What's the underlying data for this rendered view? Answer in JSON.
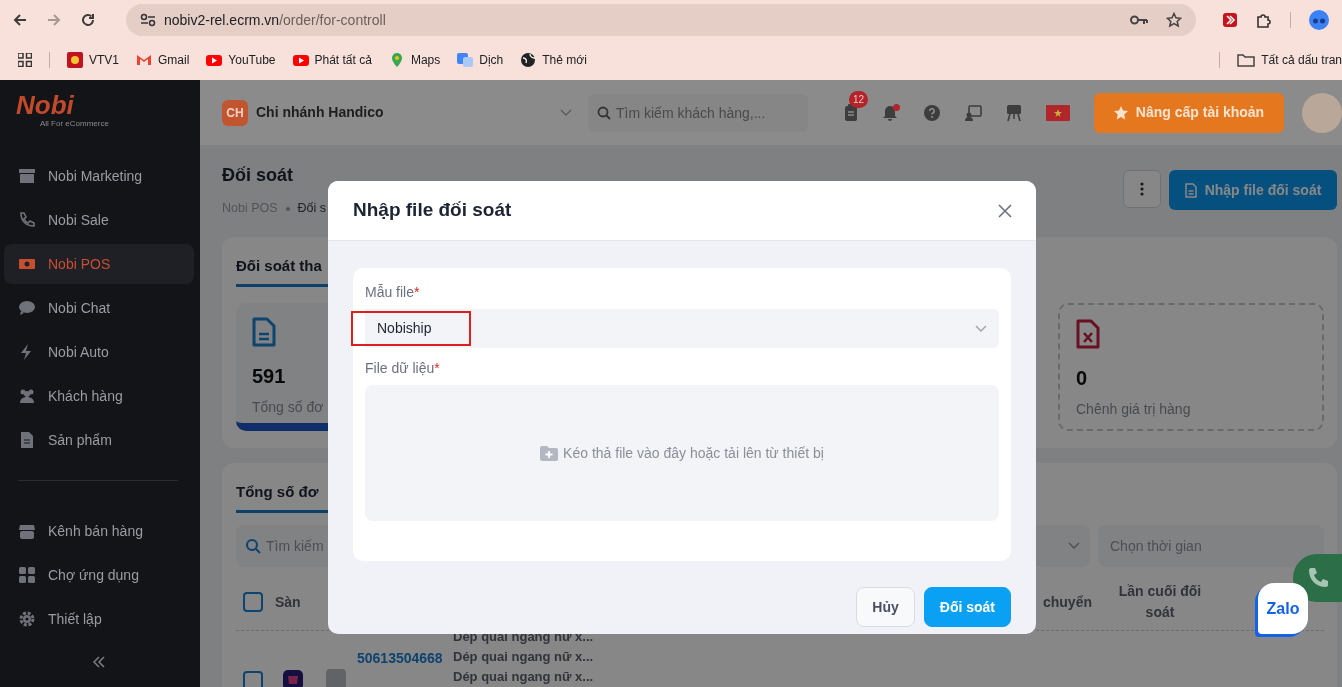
{
  "browser": {
    "url_domain": "nobiv2-rel.ecrm.vn",
    "url_path": "/order/for-controll",
    "forward_disabled": true,
    "bookmarks": [
      {
        "label": "VTV1"
      },
      {
        "label": "Gmail"
      },
      {
        "label": "YouTube"
      },
      {
        "label": "Phát tất cả"
      },
      {
        "label": "Maps"
      },
      {
        "label": "Dịch"
      },
      {
        "label": "Thẻ mới"
      }
    ],
    "all_bookmarks": "Tất cả dấu tran"
  },
  "sidebar": {
    "logo": "Nobi",
    "tagline": "All For eCommerce",
    "items": [
      {
        "label": "Nobi Marketing",
        "selected": false
      },
      {
        "label": "Nobi Sale",
        "selected": false
      },
      {
        "label": "Nobi POS",
        "selected": true
      },
      {
        "label": "Nobi Chat",
        "selected": false
      },
      {
        "label": "Nobi Auto",
        "selected": false
      },
      {
        "label": "Khách hàng",
        "selected": false
      },
      {
        "label": "Sản phẩm",
        "selected": false
      }
    ],
    "tools": [
      {
        "label": "Kênh bán hàng"
      },
      {
        "label": "Chợ ứng dụng"
      },
      {
        "label": "Thiết lập"
      }
    ]
  },
  "header": {
    "branch_initials": "CH",
    "branch": "Chi nhánh Handico",
    "search_placeholder": "Tìm kiếm khách hàng,...",
    "task_count": "12",
    "notification_dot": true,
    "upgrade": "Nâng cấp tài khoản"
  },
  "page": {
    "title": "Đối soát",
    "breadcrumb": [
      "Nobi POS",
      "Đối s"
    ],
    "import_button": "Nhập file đối soát"
  },
  "summary": {
    "tab": "Đối soát tha",
    "stats": [
      {
        "kind": "total",
        "value": "591",
        "label": "Tổng số đơ"
      },
      {
        "kind": "difference",
        "value": "0",
        "label": "Chênh giá trị hàng"
      }
    ]
  },
  "orders": {
    "tab": "Tổng số đơ",
    "search_placeholder": "Tìm kiếm",
    "date_placeholder": "Chọn thời gian",
    "all_checked": false,
    "columns": [
      "Sàn",
      "chuyển",
      "Lần cuối đối soát"
    ],
    "rows": [
      {
        "checked": false,
        "order_ids": [
          "50613504668"
        ],
        "products": [
          "Dép quai ngang nữ x...",
          "Dép quai ngang nữ x...",
          "Dép quai ngang nữ x..."
        ]
      }
    ]
  },
  "modal": {
    "title": "Nhập file đối soát",
    "fields": [
      {
        "kind": "select",
        "label": "Mẫu file",
        "required_mark": "*",
        "value": "Nobiship",
        "highlighted": true
      },
      {
        "kind": "dropzone",
        "label": "File dữ liệu",
        "required_mark": "*",
        "hint": "Kéo thả file vào đây hoặc tải lên từ thiết bị"
      }
    ],
    "buttons": [
      {
        "label": "Hủy",
        "kind": "secondary"
      },
      {
        "label": "Đối soát",
        "kind": "primary"
      }
    ]
  },
  "chat_widget": {
    "label": "Zalo"
  }
}
